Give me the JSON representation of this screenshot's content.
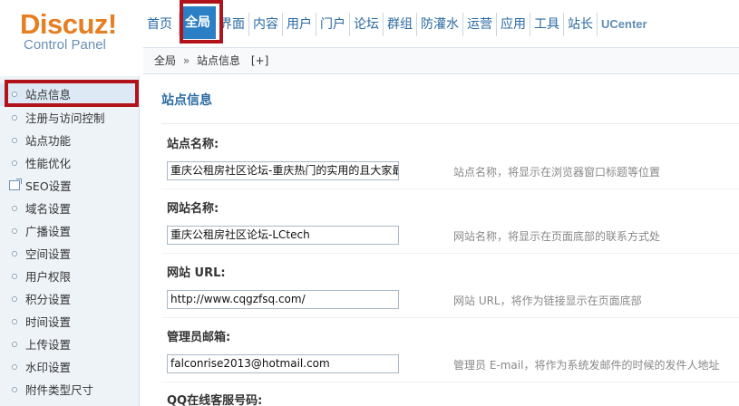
{
  "header": {
    "logo_main": "Discuz",
    "logo_excl": "!",
    "logo_sub": "Control Panel"
  },
  "nav": {
    "items": [
      "首页",
      "全局",
      "界面",
      "内容",
      "用户",
      "门户",
      "论坛",
      "群组",
      "防灌水",
      "运营",
      "应用",
      "工具",
      "站长",
      "UCenter"
    ],
    "active_index": 1
  },
  "breadcrumb": {
    "root": "全局",
    "sep": "»",
    "current": "站点信息",
    "add": "[+]"
  },
  "sidebar": {
    "items": [
      "站点信息",
      "注册与访问控制",
      "站点功能",
      "性能优化",
      "SEO设置",
      "域名设置",
      "广播设置",
      "空间设置",
      "用户权限",
      "积分设置",
      "时间设置",
      "上传设置",
      "水印设置",
      "附件类型尺寸"
    ],
    "active_index": 0,
    "external_index": 4
  },
  "main": {
    "section_title": "站点信息",
    "rows": [
      {
        "label": "站点名称:",
        "value": "重庆公租房社区论坛-重庆热门的实用的且大家最",
        "help": "站点名称，将显示在浏览器窗口标题等位置"
      },
      {
        "label": "网站名称:",
        "value": "重庆公租房社区论坛-LCtech",
        "help": "网站名称，将显示在页面底部的联系方式处"
      },
      {
        "label": "网站 URL:",
        "value": "http://www.cqgzfsq.com/",
        "help": "网站 URL，将作为链接显示在页面底部"
      },
      {
        "label": "管理员邮箱:",
        "value": "falconrise2013@hotmail.com",
        "help": "管理员 E-mail，将作为系统发邮件的时候的发件人地址"
      },
      {
        "label": "QQ在线客服号码:"
      }
    ]
  },
  "colors": {
    "accent": "#2b7fc4",
    "highlight_box": "#b0141a",
    "logo": "#e67e22"
  }
}
